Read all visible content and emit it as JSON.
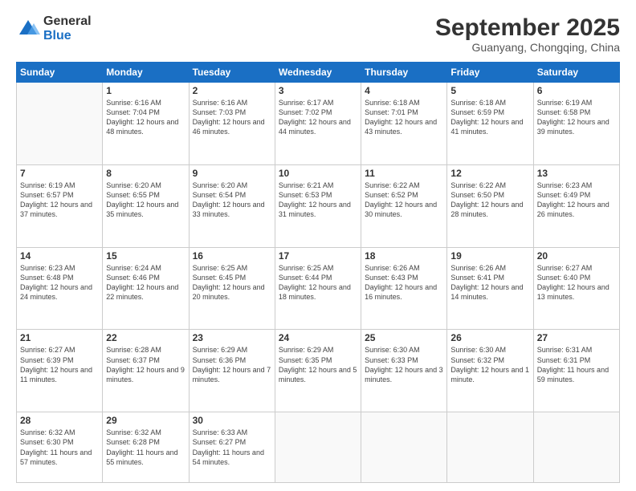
{
  "logo": {
    "general": "General",
    "blue": "Blue"
  },
  "header": {
    "month": "September 2025",
    "location": "Guanyang, Chongqing, China"
  },
  "weekdays": [
    "Sunday",
    "Monday",
    "Tuesday",
    "Wednesday",
    "Thursday",
    "Friday",
    "Saturday"
  ],
  "weeks": [
    [
      {
        "day": "",
        "sunrise": "",
        "sunset": "",
        "daylight": ""
      },
      {
        "day": "1",
        "sunrise": "Sunrise: 6:16 AM",
        "sunset": "Sunset: 7:04 PM",
        "daylight": "Daylight: 12 hours and 48 minutes."
      },
      {
        "day": "2",
        "sunrise": "Sunrise: 6:16 AM",
        "sunset": "Sunset: 7:03 PM",
        "daylight": "Daylight: 12 hours and 46 minutes."
      },
      {
        "day": "3",
        "sunrise": "Sunrise: 6:17 AM",
        "sunset": "Sunset: 7:02 PM",
        "daylight": "Daylight: 12 hours and 44 minutes."
      },
      {
        "day": "4",
        "sunrise": "Sunrise: 6:18 AM",
        "sunset": "Sunset: 7:01 PM",
        "daylight": "Daylight: 12 hours and 43 minutes."
      },
      {
        "day": "5",
        "sunrise": "Sunrise: 6:18 AM",
        "sunset": "Sunset: 6:59 PM",
        "daylight": "Daylight: 12 hours and 41 minutes."
      },
      {
        "day": "6",
        "sunrise": "Sunrise: 6:19 AM",
        "sunset": "Sunset: 6:58 PM",
        "daylight": "Daylight: 12 hours and 39 minutes."
      }
    ],
    [
      {
        "day": "7",
        "sunrise": "Sunrise: 6:19 AM",
        "sunset": "Sunset: 6:57 PM",
        "daylight": "Daylight: 12 hours and 37 minutes."
      },
      {
        "day": "8",
        "sunrise": "Sunrise: 6:20 AM",
        "sunset": "Sunset: 6:55 PM",
        "daylight": "Daylight: 12 hours and 35 minutes."
      },
      {
        "day": "9",
        "sunrise": "Sunrise: 6:20 AM",
        "sunset": "Sunset: 6:54 PM",
        "daylight": "Daylight: 12 hours and 33 minutes."
      },
      {
        "day": "10",
        "sunrise": "Sunrise: 6:21 AM",
        "sunset": "Sunset: 6:53 PM",
        "daylight": "Daylight: 12 hours and 31 minutes."
      },
      {
        "day": "11",
        "sunrise": "Sunrise: 6:22 AM",
        "sunset": "Sunset: 6:52 PM",
        "daylight": "Daylight: 12 hours and 30 minutes."
      },
      {
        "day": "12",
        "sunrise": "Sunrise: 6:22 AM",
        "sunset": "Sunset: 6:50 PM",
        "daylight": "Daylight: 12 hours and 28 minutes."
      },
      {
        "day": "13",
        "sunrise": "Sunrise: 6:23 AM",
        "sunset": "Sunset: 6:49 PM",
        "daylight": "Daylight: 12 hours and 26 minutes."
      }
    ],
    [
      {
        "day": "14",
        "sunrise": "Sunrise: 6:23 AM",
        "sunset": "Sunset: 6:48 PM",
        "daylight": "Daylight: 12 hours and 24 minutes."
      },
      {
        "day": "15",
        "sunrise": "Sunrise: 6:24 AM",
        "sunset": "Sunset: 6:46 PM",
        "daylight": "Daylight: 12 hours and 22 minutes."
      },
      {
        "day": "16",
        "sunrise": "Sunrise: 6:25 AM",
        "sunset": "Sunset: 6:45 PM",
        "daylight": "Daylight: 12 hours and 20 minutes."
      },
      {
        "day": "17",
        "sunrise": "Sunrise: 6:25 AM",
        "sunset": "Sunset: 6:44 PM",
        "daylight": "Daylight: 12 hours and 18 minutes."
      },
      {
        "day": "18",
        "sunrise": "Sunrise: 6:26 AM",
        "sunset": "Sunset: 6:43 PM",
        "daylight": "Daylight: 12 hours and 16 minutes."
      },
      {
        "day": "19",
        "sunrise": "Sunrise: 6:26 AM",
        "sunset": "Sunset: 6:41 PM",
        "daylight": "Daylight: 12 hours and 14 minutes."
      },
      {
        "day": "20",
        "sunrise": "Sunrise: 6:27 AM",
        "sunset": "Sunset: 6:40 PM",
        "daylight": "Daylight: 12 hours and 13 minutes."
      }
    ],
    [
      {
        "day": "21",
        "sunrise": "Sunrise: 6:27 AM",
        "sunset": "Sunset: 6:39 PM",
        "daylight": "Daylight: 12 hours and 11 minutes."
      },
      {
        "day": "22",
        "sunrise": "Sunrise: 6:28 AM",
        "sunset": "Sunset: 6:37 PM",
        "daylight": "Daylight: 12 hours and 9 minutes."
      },
      {
        "day": "23",
        "sunrise": "Sunrise: 6:29 AM",
        "sunset": "Sunset: 6:36 PM",
        "daylight": "Daylight: 12 hours and 7 minutes."
      },
      {
        "day": "24",
        "sunrise": "Sunrise: 6:29 AM",
        "sunset": "Sunset: 6:35 PM",
        "daylight": "Daylight: 12 hours and 5 minutes."
      },
      {
        "day": "25",
        "sunrise": "Sunrise: 6:30 AM",
        "sunset": "Sunset: 6:33 PM",
        "daylight": "Daylight: 12 hours and 3 minutes."
      },
      {
        "day": "26",
        "sunrise": "Sunrise: 6:30 AM",
        "sunset": "Sunset: 6:32 PM",
        "daylight": "Daylight: 12 hours and 1 minute."
      },
      {
        "day": "27",
        "sunrise": "Sunrise: 6:31 AM",
        "sunset": "Sunset: 6:31 PM",
        "daylight": "Daylight: 11 hours and 59 minutes."
      }
    ],
    [
      {
        "day": "28",
        "sunrise": "Sunrise: 6:32 AM",
        "sunset": "Sunset: 6:30 PM",
        "daylight": "Daylight: 11 hours and 57 minutes."
      },
      {
        "day": "29",
        "sunrise": "Sunrise: 6:32 AM",
        "sunset": "Sunset: 6:28 PM",
        "daylight": "Daylight: 11 hours and 55 minutes."
      },
      {
        "day": "30",
        "sunrise": "Sunrise: 6:33 AM",
        "sunset": "Sunset: 6:27 PM",
        "daylight": "Daylight: 11 hours and 54 minutes."
      },
      {
        "day": "",
        "sunrise": "",
        "sunset": "",
        "daylight": ""
      },
      {
        "day": "",
        "sunrise": "",
        "sunset": "",
        "daylight": ""
      },
      {
        "day": "",
        "sunrise": "",
        "sunset": "",
        "daylight": ""
      },
      {
        "day": "",
        "sunrise": "",
        "sunset": "",
        "daylight": ""
      }
    ]
  ]
}
